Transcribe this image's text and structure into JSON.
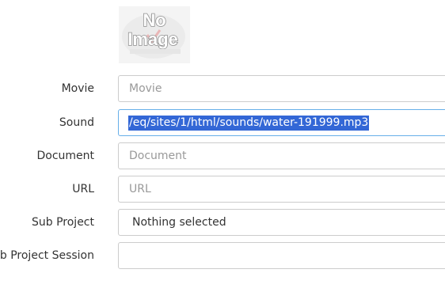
{
  "image_placeholder": {
    "line1": "No",
    "line2": "Image"
  },
  "form": {
    "movie": {
      "label": "Movie",
      "placeholder": "Movie"
    },
    "sound": {
      "label": "Sound",
      "value": "/eq/sites/1/html/sounds/water-191999.mp3"
    },
    "document": {
      "label": "Document",
      "placeholder": "Document"
    },
    "url": {
      "label": "URL",
      "placeholder": "URL"
    },
    "sub_project": {
      "label": "Sub Project",
      "value": "Nothing selected"
    },
    "sub_project_session": {
      "label": "ub Project Session",
      "value": ""
    }
  },
  "colors": {
    "selection": "#3367d6",
    "focus_border": "#66afe9",
    "border": "#cccccc"
  }
}
